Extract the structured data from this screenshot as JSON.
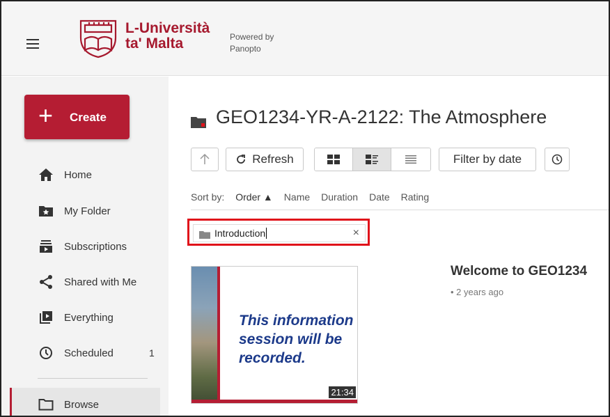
{
  "header": {
    "logo_line1": "L-Università",
    "logo_line2": "ta' Malta",
    "powered_line1": "Powered by",
    "powered_line2": "Panopto"
  },
  "sidebar": {
    "create_label": "Create",
    "items": [
      {
        "label": "Home",
        "icon": "home-icon"
      },
      {
        "label": "My Folder",
        "icon": "star-folder-icon"
      },
      {
        "label": "Subscriptions",
        "icon": "subscriptions-icon"
      },
      {
        "label": "Shared with Me",
        "icon": "share-icon"
      },
      {
        "label": "Everything",
        "icon": "everything-icon"
      },
      {
        "label": "Scheduled",
        "icon": "clock-icon",
        "count": "1"
      },
      {
        "label": "Browse",
        "icon": "folder-outline-icon"
      }
    ]
  },
  "main": {
    "folder_title": "GEO1234-YR-A-2122: The Atmosphere",
    "toolbar": {
      "refresh_label": "Refresh",
      "filter_label": "Filter by date"
    },
    "sort": {
      "prefix": "Sort by:",
      "options": [
        "Order ▲",
        "Name",
        "Duration",
        "Date",
        "Rating"
      ]
    },
    "chip": {
      "label": "Introduction",
      "close": "×"
    },
    "video": {
      "title": "Welcome to GEO1234",
      "meta": "• 2 years ago",
      "duration": "21:34",
      "slide_text": "This information session will be recorded."
    }
  },
  "colors": {
    "brand": "#b51d33",
    "highlight": "#e0121a"
  }
}
